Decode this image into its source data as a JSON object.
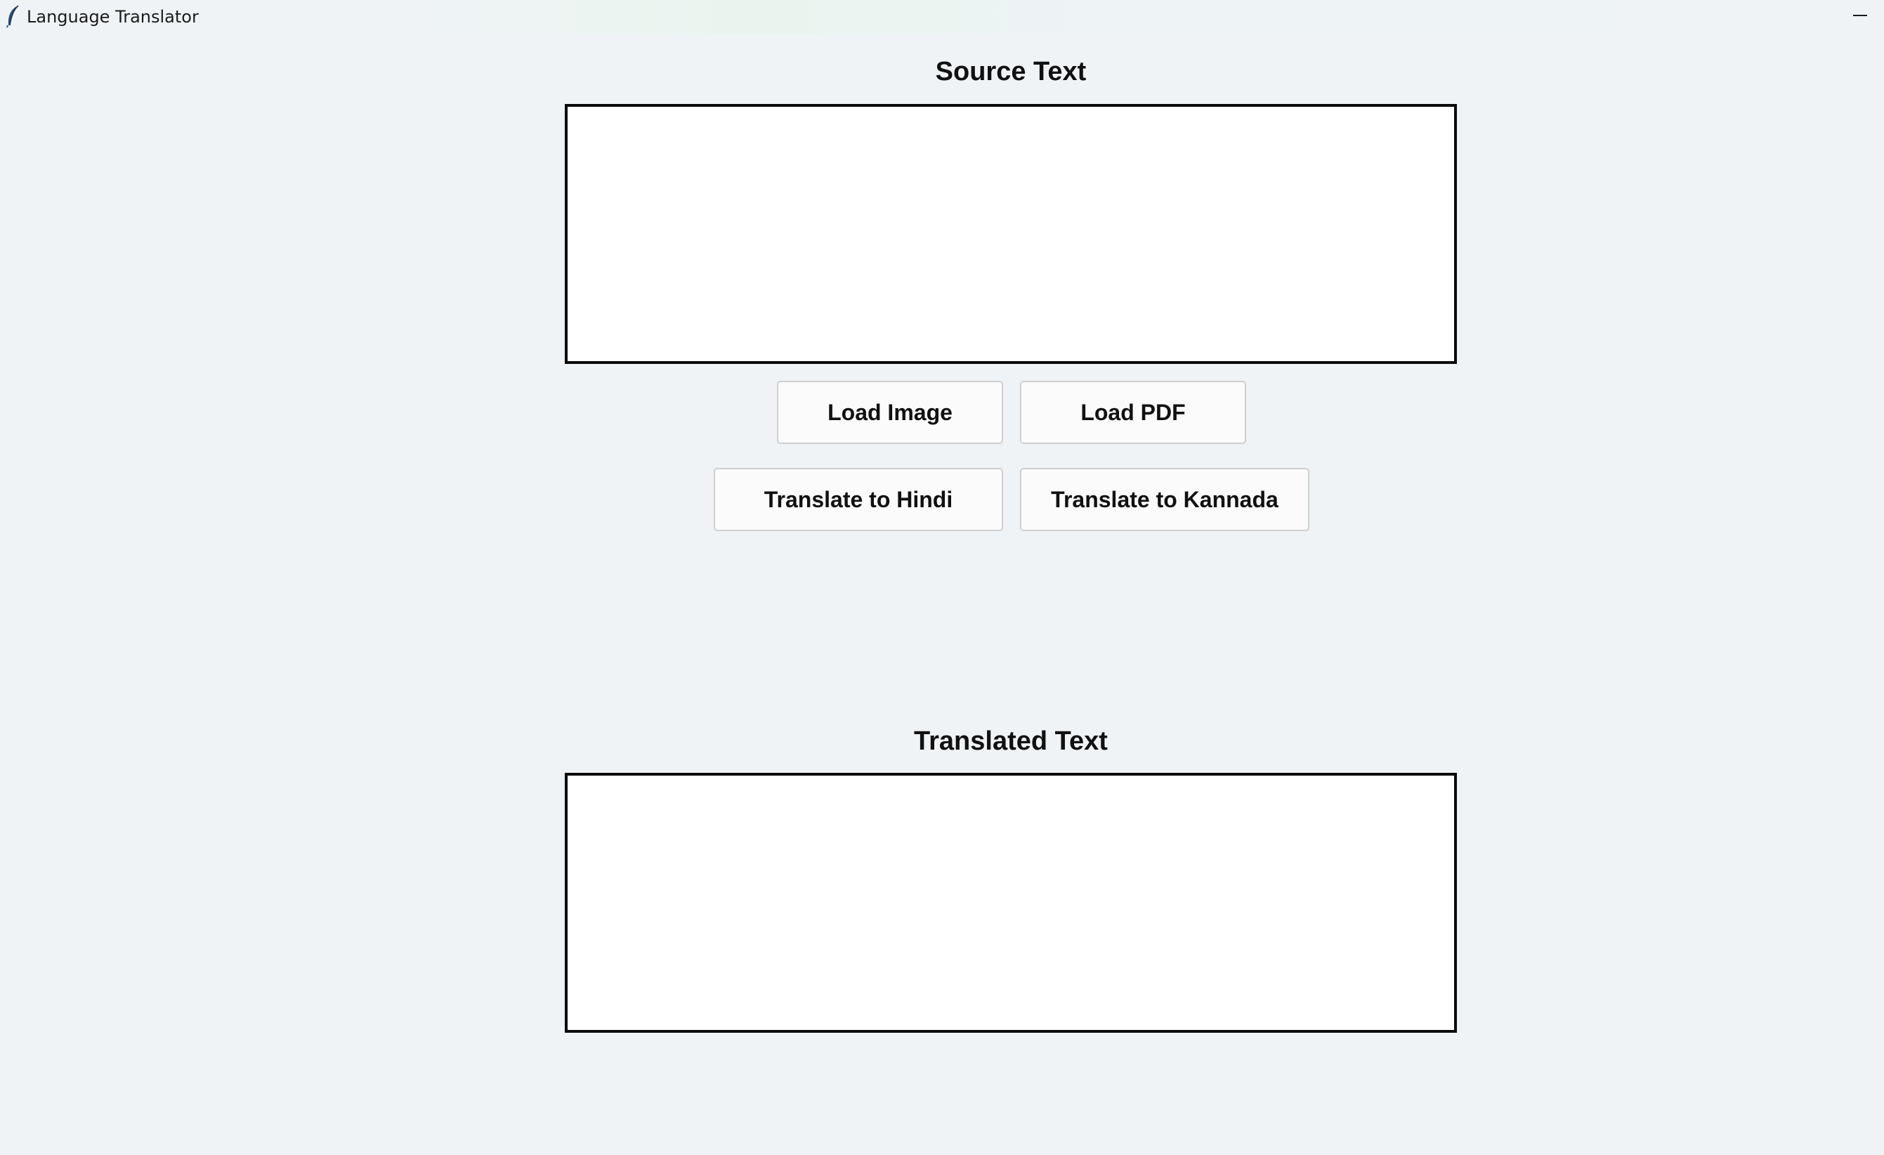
{
  "window": {
    "title": "Language Translator",
    "icon": "feather-icon",
    "minimize_glyph": "minimize-icon"
  },
  "source": {
    "heading": "Source Text",
    "value": ""
  },
  "actions": {
    "load_image_label": "Load Image",
    "load_pdf_label": "Load PDF",
    "translate_hindi_label": "Translate to Hindi",
    "translate_kannada_label": "Translate to Kannada"
  },
  "translated": {
    "heading": "Translated Text",
    "value": ""
  },
  "colors": {
    "background": "#eff3f6",
    "textbox_border": "#0a0a0a",
    "button_bg": "#fbfbfb",
    "button_border": "#cfcfcf"
  }
}
